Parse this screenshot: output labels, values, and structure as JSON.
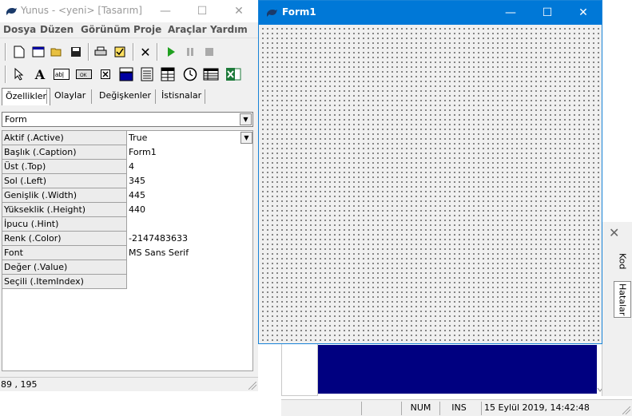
{
  "ide": {
    "title": "Yunus - <yeni> [Tasarım]",
    "menu": [
      "Dosya",
      "Düzen",
      "Görünüm",
      "Proje",
      "Araçlar",
      "Yardım"
    ],
    "tabs": [
      "Özellikler",
      "Olaylar",
      "Değişkenler",
      "İstisnalar"
    ],
    "object_selector": "Form",
    "properties": [
      {
        "name": "Aktif (.Active)",
        "value": "True"
      },
      {
        "name": "Başlık (.Caption)",
        "value": "Form1"
      },
      {
        "name": "Üst (.Top)",
        "value": "4"
      },
      {
        "name": "Sol (.Left)",
        "value": "345"
      },
      {
        "name": "Genişlik (.Width)",
        "value": "445"
      },
      {
        "name": "Yükseklik (.Height)",
        "value": "440"
      },
      {
        "name": "İpucu (.Hint)",
        "value": ""
      },
      {
        "name": "Renk (.Color)",
        "value": "-2147483633"
      },
      {
        "name": "Font",
        "value": "MS Sans Serif"
      },
      {
        "name": "Değer (.Value)",
        "value": ""
      },
      {
        "name": "Seçili (.ItemIndex)",
        "value": ""
      }
    ],
    "status_coords": "89 , 195"
  },
  "form": {
    "title": "Form1"
  },
  "code_window": {
    "side_tabs": [
      "Kod",
      "Hatalar"
    ],
    "status": {
      "num": "NUM",
      "ins": "INS",
      "datetime": "15 Eylül 2019, 14:42:48"
    }
  },
  "colors": {
    "form_titlebar": "#0078d7",
    "code_highlight": "#000080"
  },
  "icons": [
    "dolphin-icon",
    "new-file-icon",
    "new-form-icon",
    "open-folder-icon",
    "save-icon",
    "print-icon",
    "check-icon",
    "delete-icon",
    "run-icon",
    "pause-icon",
    "stop-icon",
    "pointer-icon",
    "label-tool-icon",
    "textbox-tool-icon",
    "button-tool-icon",
    "checkbox-tool-icon",
    "combobox-tool-icon",
    "listbox-tool-icon",
    "grid-tool-icon",
    "timer-tool-icon",
    "table-tool-icon",
    "excel-tool-icon"
  ]
}
